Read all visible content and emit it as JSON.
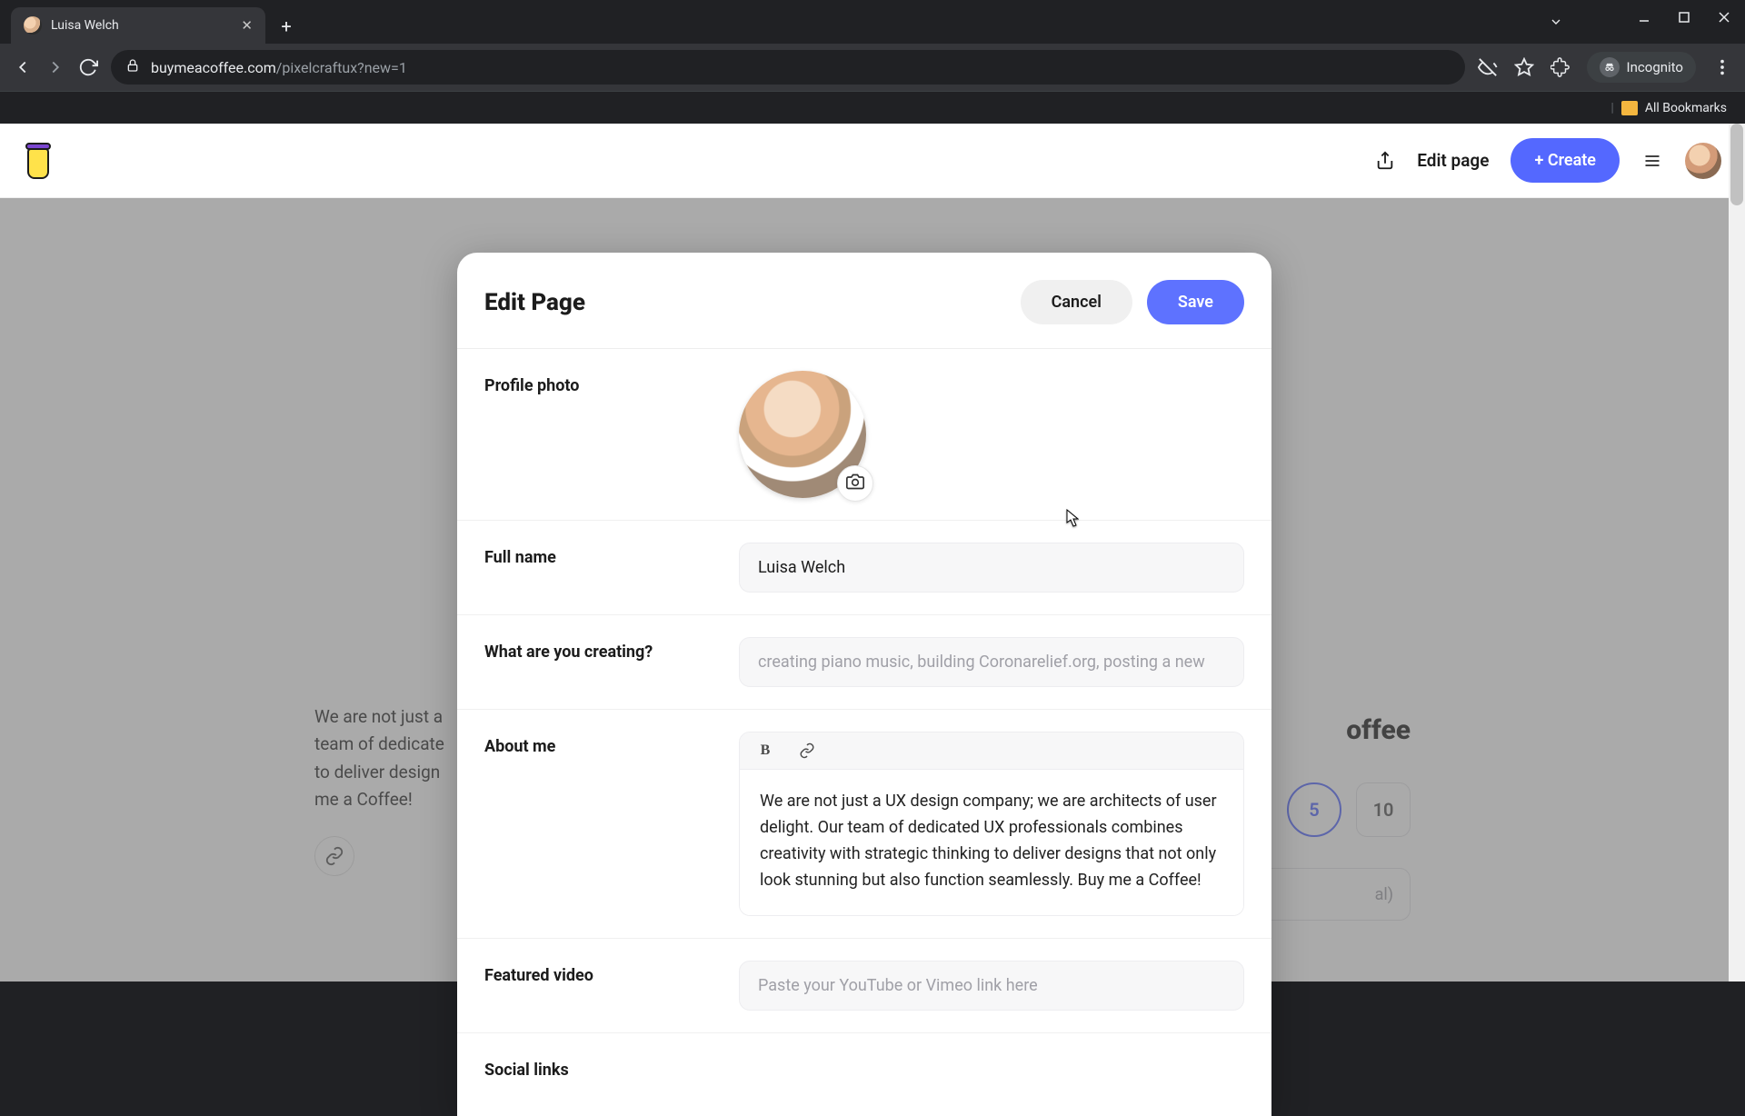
{
  "browser": {
    "tab_title": "Luisa Welch",
    "url_host": "buymeacoffee.com",
    "url_path": "/pixelcraftux?new=1",
    "incognito_label": "Incognito",
    "bookmarks_label": "All Bookmarks"
  },
  "header": {
    "edit_page": "Edit page",
    "create": "+ Create"
  },
  "background": {
    "about_text_partial": "We are not just a\nteam of dedicate\nto deliver design\nme a Coffee!",
    "right_title_partial": "offee",
    "tips": {
      "option5": "5",
      "option10": "10"
    },
    "optional_suffix": "al)"
  },
  "modal": {
    "title": "Edit Page",
    "cancel": "Cancel",
    "save": "Save",
    "labels": {
      "profile_photo": "Profile photo",
      "full_name": "Full name",
      "creating": "What are you creating?",
      "about": "About me",
      "featured_video": "Featured video",
      "social_links": "Social links"
    },
    "full_name_value": "Luisa Welch",
    "creating_placeholder": "creating piano music, building Coronarelief.org, posting a new",
    "about_value": "We are not just a UX design company; we are architects of user delight. Our team of dedicated UX professionals combines creativity with strategic thinking to deliver designs that not only look stunning but also function seamlessly. Buy me a Coffee!",
    "video_placeholder": "Paste your YouTube or Vimeo link here"
  }
}
